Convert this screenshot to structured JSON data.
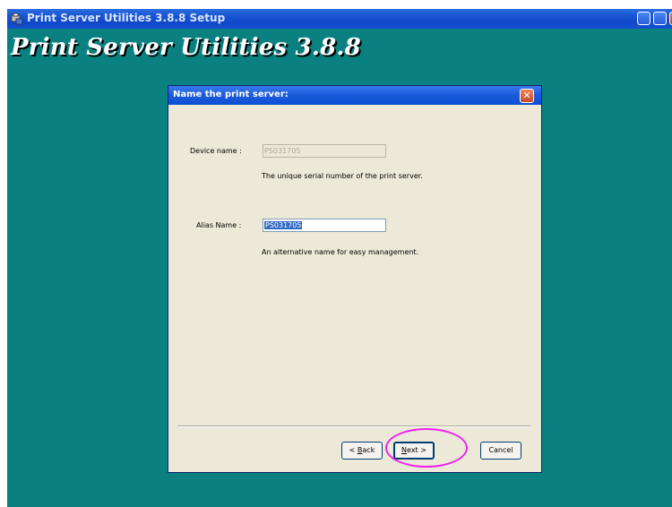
{
  "window": {
    "title": "Print Server Utilities 3.8.8 Setup",
    "banner": "Print Server Utilities 3.8.8"
  },
  "dialog": {
    "title": "Name the print server:",
    "device_name_label": "Device name :",
    "device_name_value": "PS031705",
    "device_name_desc": "The unique serial number of the print server.",
    "alias_label": "Alias Name :",
    "alias_value": "PS031705",
    "alias_desc": "An alternative name for easy management.",
    "back_prefix": "< ",
    "back_accel": "B",
    "back_rest": "ack",
    "next_accel": "N",
    "next_rest": "ext >",
    "cancel_label": "Cancel"
  },
  "colors": {
    "desktop": "#0a8080",
    "dialog_bg": "#ece9d8",
    "titlebar": "#1c5bdb",
    "highlight": "#ee22ee"
  }
}
